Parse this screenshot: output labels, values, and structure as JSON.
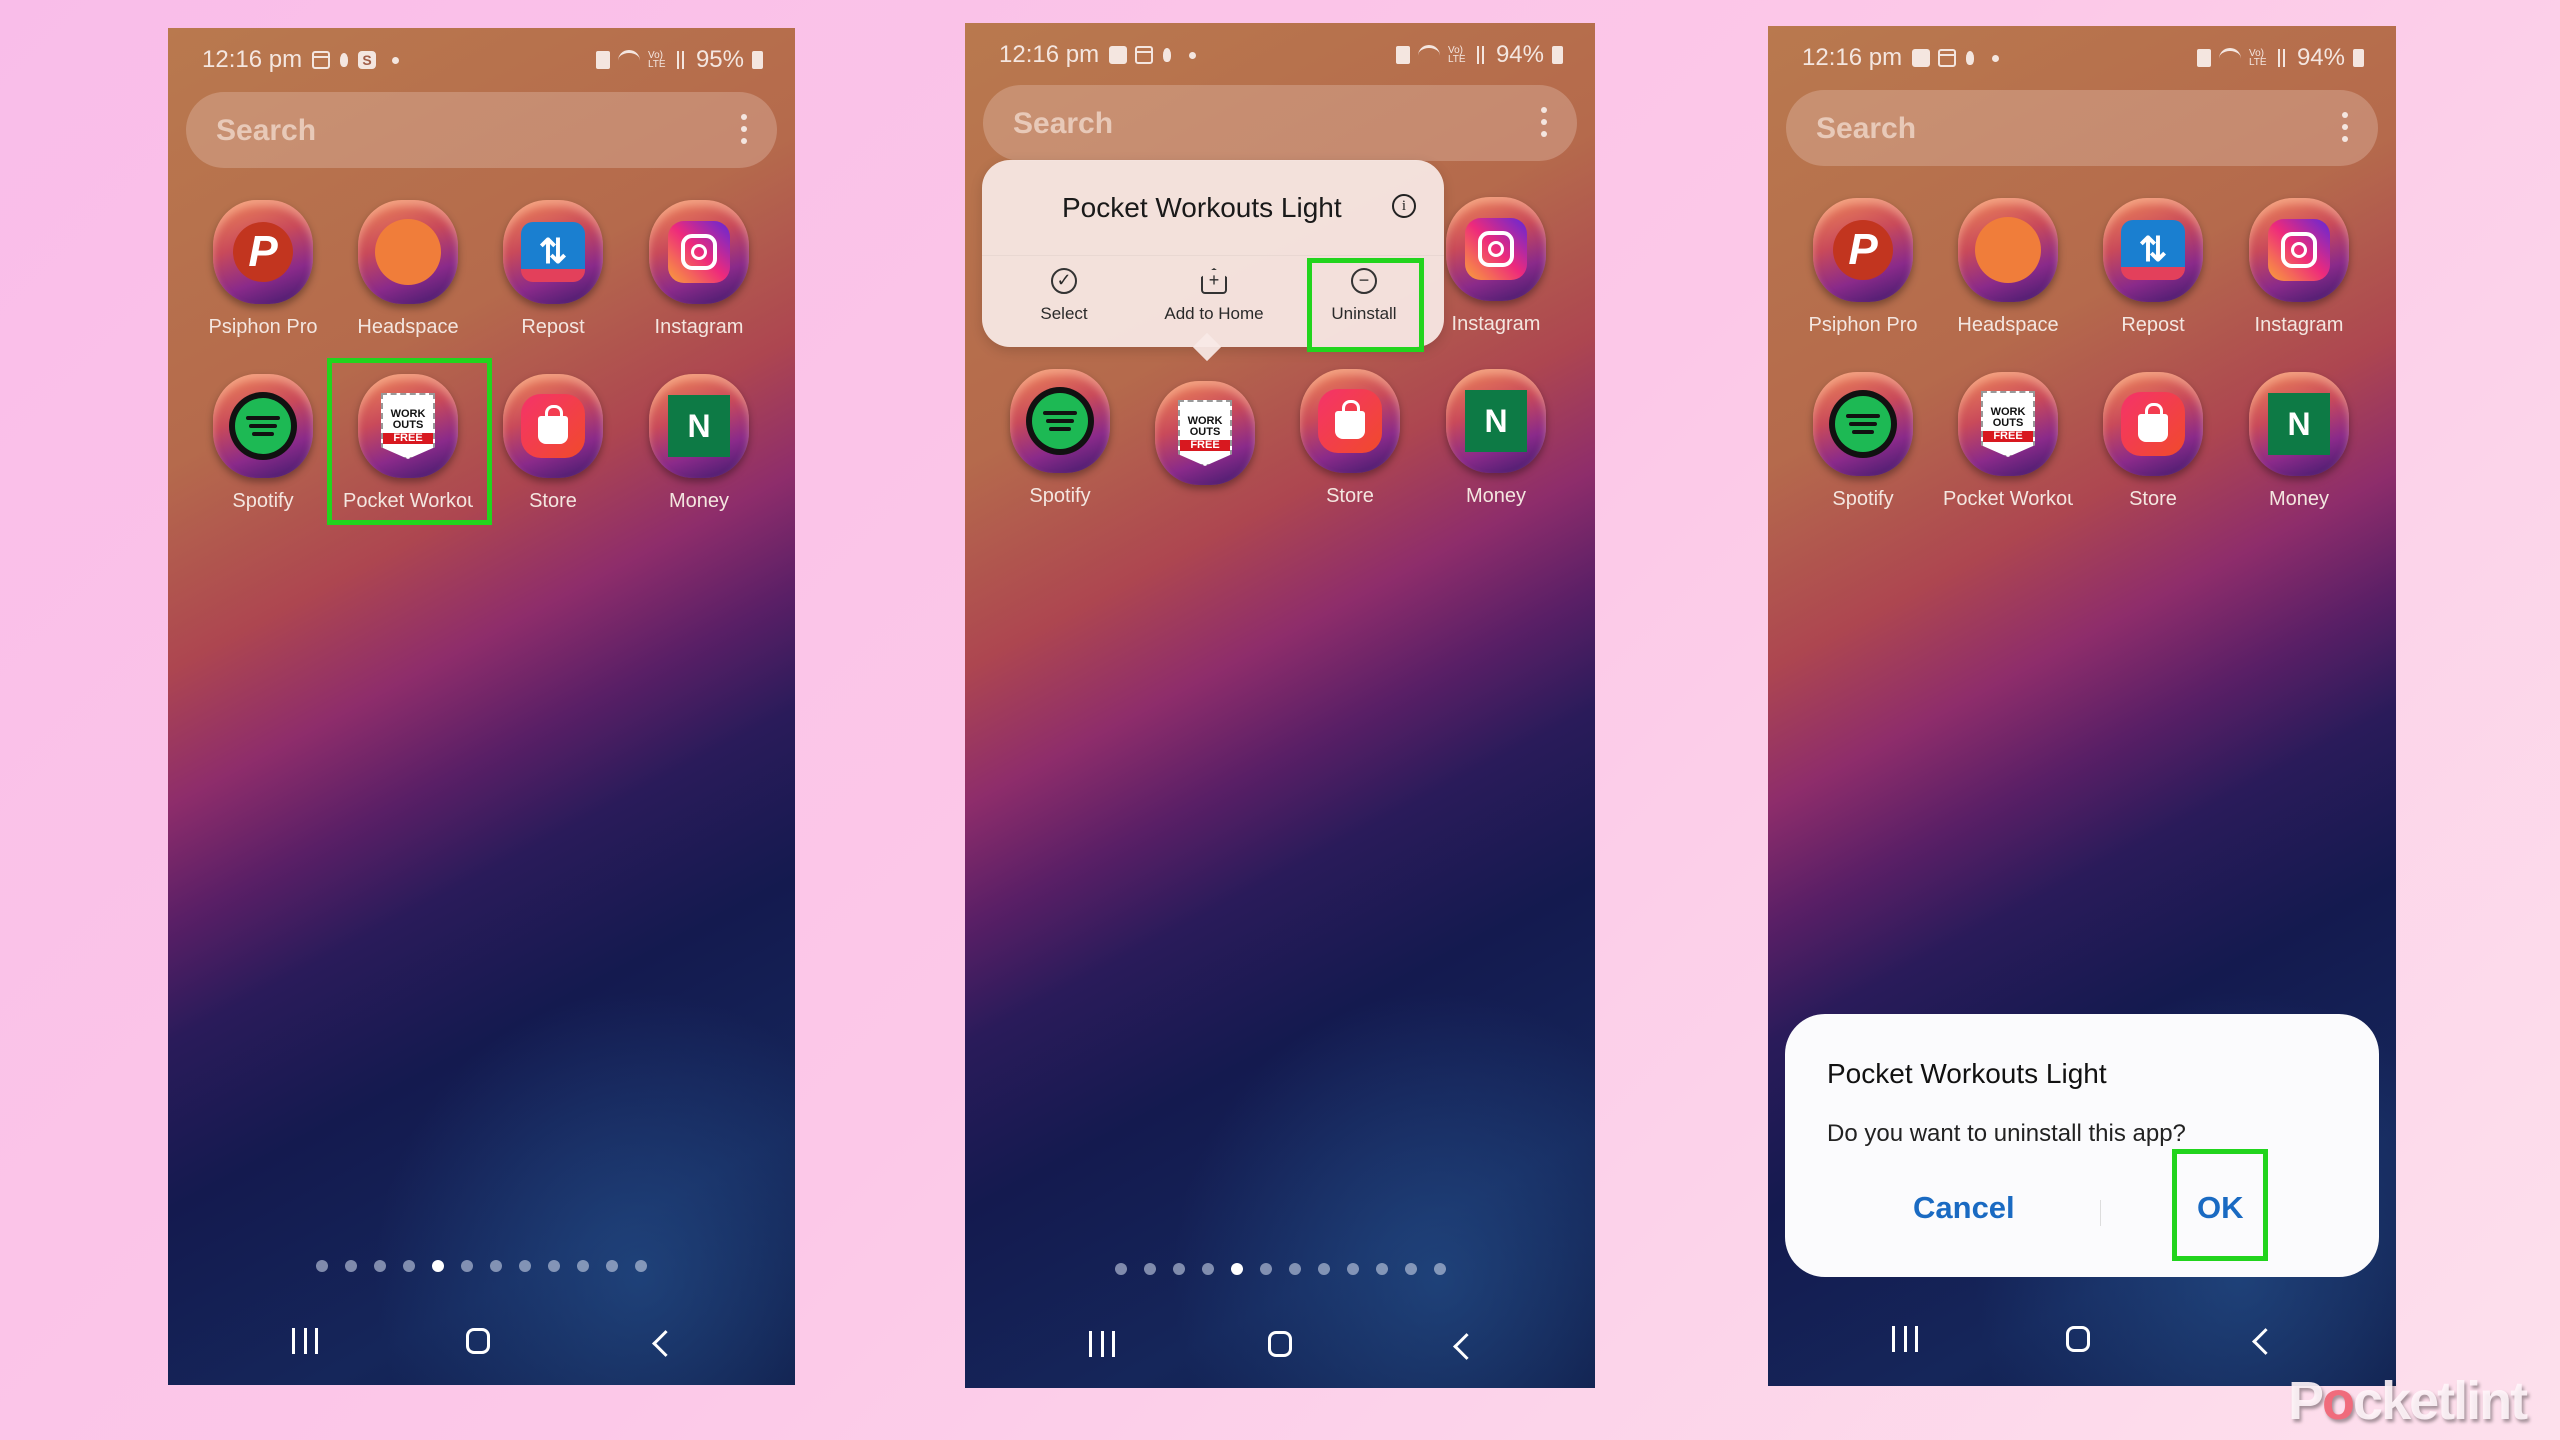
{
  "panels": [
    {
      "status": {
        "time": "12:16 pm",
        "battery": "95%"
      },
      "search": {
        "placeholder": "Search"
      },
      "apps": [
        "Psiphon Pro",
        "Headspace",
        "Repost",
        "Instagram",
        "Spotify",
        "Pocket Workou...",
        "Store",
        "Money"
      ],
      "page_dots": {
        "count": 12,
        "active_index": 4
      }
    },
    {
      "status": {
        "time": "12:16 pm",
        "battery": "94%"
      },
      "search": {
        "placeholder": "Search"
      },
      "apps": [
        "Instagram",
        "Spotify",
        "Store",
        "Money"
      ],
      "context_menu": {
        "title": "Pocket Workouts Light",
        "actions": [
          "Select",
          "Add to Home",
          "Uninstall"
        ]
      },
      "page_dots": {
        "count": 12,
        "active_index": 4
      }
    },
    {
      "status": {
        "time": "12:16 pm",
        "battery": "94%"
      },
      "search": {
        "placeholder": "Search"
      },
      "apps": [
        "Psiphon Pro",
        "Headspace",
        "Repost",
        "Instagram",
        "Spotify",
        "Pocket Workou...",
        "Store",
        "Money"
      ],
      "dialog": {
        "title": "Pocket Workouts Light",
        "message": "Do you want to uninstall this app?",
        "cancel_label": "Cancel",
        "ok_label": "OK"
      }
    }
  ],
  "app_icons": {
    "psiphon": "P",
    "repost": "⇅",
    "work_line1": "WORK",
    "work_line2": "OUTS",
    "work_free": "FREE",
    "money": "N"
  },
  "highlight_color": "#22d41d",
  "watermark": {
    "pre": "P",
    "o": "o",
    "post": "cketlint"
  }
}
